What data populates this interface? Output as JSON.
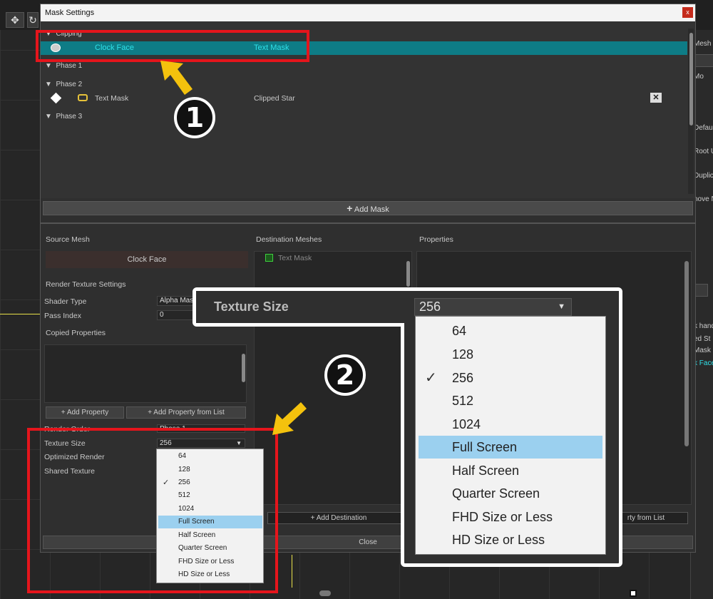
{
  "dialog": {
    "title": "Mask Settings",
    "close_glyph": "x"
  },
  "mask_list": {
    "groups": [
      {
        "label": "Clipping"
      },
      {
        "label": "Phase 1"
      },
      {
        "label": "Phase 2"
      },
      {
        "label": "Phase 3"
      }
    ],
    "clipping_row": {
      "source": "Clock Face",
      "destination": "Text Mask"
    },
    "phase2_row": {
      "source": "Text Mask",
      "destination": "Clipped Star"
    }
  },
  "add_mask_label": "Add Mask",
  "source_mesh": {
    "header": "Source Mesh",
    "value": "Clock Face"
  },
  "destination_meshes": {
    "header": "Destination Meshes",
    "items": [
      "Text Mask"
    ],
    "add_destination_label": "Add Destination"
  },
  "properties": {
    "header": "Properties",
    "add_from_list_partial": "rty from List"
  },
  "render_texture": {
    "header": "Render Texture Settings",
    "shader_type_label": "Shader Type",
    "shader_type_value": "Alpha Mas",
    "pass_index_label": "Pass Index",
    "pass_index_value": "0",
    "copied_properties_header": "Copied Properties",
    "add_property_label": "Add Property",
    "add_property_from_list_label": "Add Property from List",
    "render_order_label": "Render Order",
    "render_order_value": "Phase 1",
    "texture_size_label": "Texture Size",
    "texture_size_value": "256",
    "optimized_render_label": "Optimized Render",
    "shared_texture_label": "Shared Texture"
  },
  "texture_size_options": [
    "64",
    "128",
    "256",
    "512",
    "1024",
    "Full Screen",
    "Half Screen",
    "Quarter Screen",
    "FHD Size or Less",
    "HD Size or Less"
  ],
  "texture_size_checked": "256",
  "texture_size_highlighted": "Full Screen",
  "close_button_label": "Close",
  "zoom": {
    "label": "Texture Size",
    "value": "256"
  },
  "annotations": {
    "badge1": "1",
    "badge2": "2"
  },
  "right_panel": {
    "items": [
      "Mesh",
      "Mo",
      "Defau",
      "Root U",
      "Duplic",
      "nove N",
      "k hand",
      "ed St",
      "Mask",
      "k Face"
    ]
  },
  "colors": {
    "accent_teal": "#0e7c86",
    "highlight_blue": "#9bd0ef",
    "annotation_red": "#e5151c",
    "annotation_yellow": "#f4c20d"
  }
}
